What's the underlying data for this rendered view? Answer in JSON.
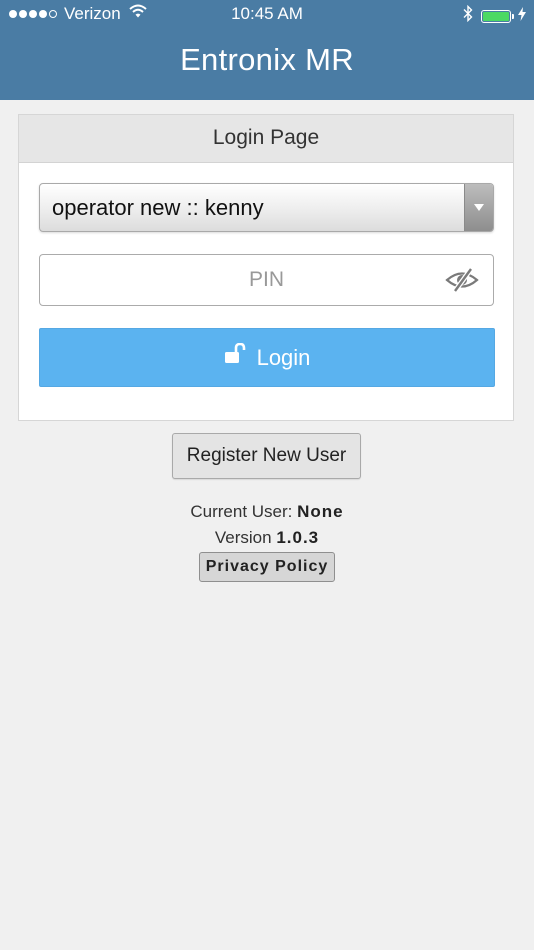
{
  "status_bar": {
    "carrier": "Verizon",
    "time": "10:45 AM",
    "signal_bars_filled": 4,
    "signal_bars_total": 5,
    "battery_level": 1.0,
    "icons": [
      "wifi-icon",
      "bluetooth-icon",
      "battery-icon",
      "charging-icon"
    ]
  },
  "header": {
    "title": "Entronix MR",
    "color": "#4a7ca4"
  },
  "login_card": {
    "title": "Login Page",
    "user_select": {
      "selected": "operator new :: kenny"
    },
    "pin_field": {
      "placeholder": "PIN",
      "value": "",
      "toggle_icon": "eye-slash-icon"
    },
    "login_button": {
      "label": "Login",
      "icon": "unlock-icon",
      "color": "#5bb3f0"
    }
  },
  "register_button": {
    "label": "Register New User"
  },
  "footer_info": {
    "current_user_label": "Current User:",
    "current_user_value": "None",
    "version_label": "Version",
    "version_value": "1.0.3"
  },
  "privacy_button": {
    "label": "Privacy Policy"
  }
}
